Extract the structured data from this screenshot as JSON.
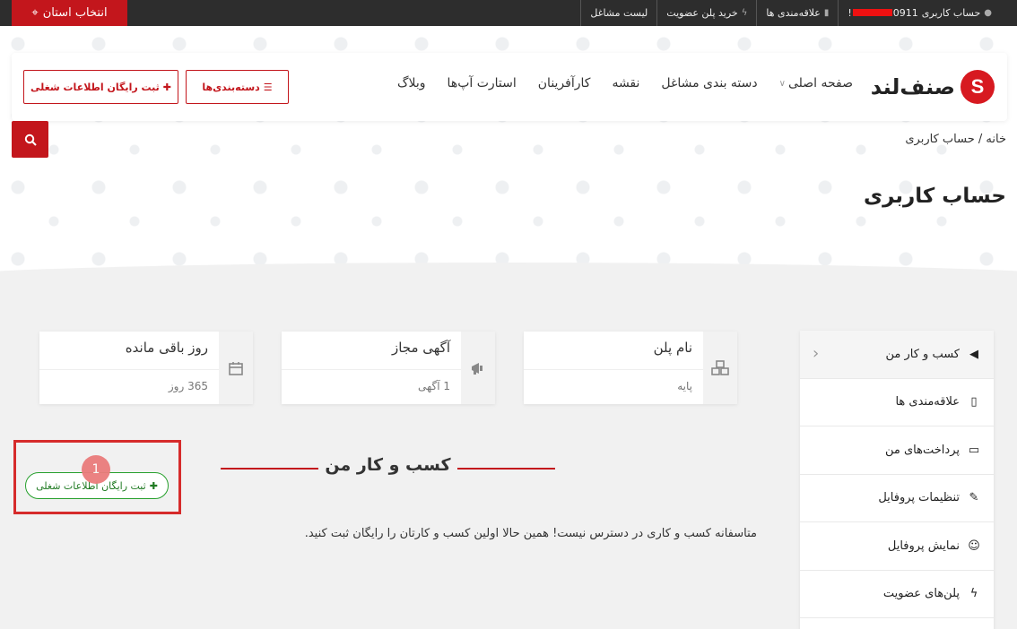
{
  "topbar": {
    "province_button": "انتخاب استان",
    "account_label": "حساب کاربری",
    "phone_prefix": "0911",
    "phone_suffix": "!",
    "favorites": "علاقه‌مندی ها",
    "buy_plan": "خرید پلن عضویت",
    "job_list": "لیست مشاغل"
  },
  "header": {
    "logo_mark": "S",
    "logo_text": "صنف‌لند",
    "nav": [
      "صفحه اصلی",
      "دسته بندی مشاغل",
      "نقشه",
      "کارآفرینان",
      "استارت آپ‌ها",
      "وبلاگ"
    ],
    "categories_button": "دسته‌بندی‌ها",
    "register_button": "ثبت رایگان اطلاعات شغلی"
  },
  "breadcrumb": {
    "home": "خانه",
    "separator": "/",
    "current": "حساب کاربری"
  },
  "page_title": "حساب کاربری",
  "stats": [
    {
      "title": "نام پلن",
      "value": "پایه",
      "icon": "cubes-icon"
    },
    {
      "title": "آگهی مجاز",
      "value": "1 آگهی",
      "icon": "megaphone-icon"
    },
    {
      "title": "روز باقی مانده",
      "value": "365 روز",
      "icon": "calendar-icon"
    }
  ],
  "sidebar": {
    "items": [
      {
        "label": "کسب و کار من",
        "icon": "megaphone-icon"
      },
      {
        "label": "علاقه‌مندی ها",
        "icon": "bookmark-icon"
      },
      {
        "label": "پرداخت‌های من",
        "icon": "credit-card-icon"
      },
      {
        "label": "تنظیمات پروفایل",
        "icon": "edit-icon"
      },
      {
        "label": "نمایش پروفایل",
        "icon": "user-icon"
      },
      {
        "label": "پلن‌های عضویت",
        "icon": "bolt-icon"
      }
    ]
  },
  "section": {
    "title": "کسب و کار من",
    "register_button": "ثبت رایگان اطلاعات شغلی",
    "badge": "1",
    "empty_message": "متاسفانه کسب و کاری در دسترس نیست! همین حالا اولین کسب و کارتان را رایگان ثبت کنید."
  },
  "colors": {
    "brand_red": "#c3161c",
    "green": "#27a02d",
    "topbar": "#2d2d2d"
  }
}
